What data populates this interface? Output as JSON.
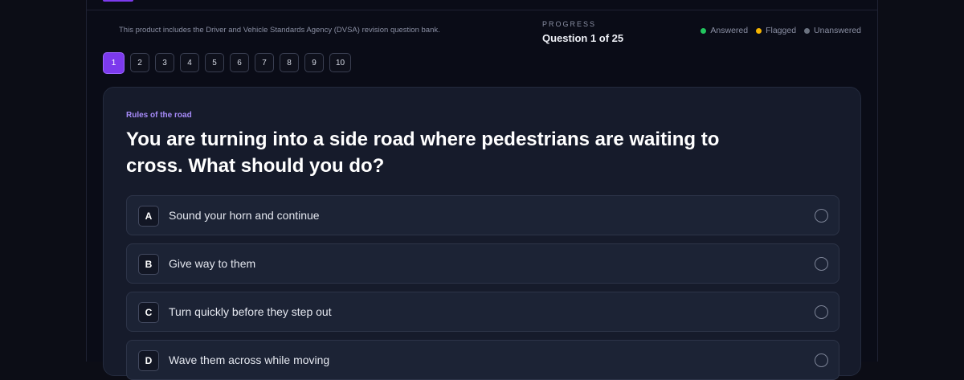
{
  "header": {
    "disclaimer": "This product includes the Driver and Vehicle Standards Agency (DVSA) revision question bank.",
    "progress_label": "PROGRESS",
    "progress_value": "Question 1 of 25"
  },
  "legend": [
    {
      "label": "Answered",
      "color": "#22c55e"
    },
    {
      "label": "Flagged",
      "color": "#f5b400"
    },
    {
      "label": "Unanswered",
      "color": "#6b7280"
    }
  ],
  "question_nav": {
    "items": [
      "1",
      "2",
      "3",
      "4",
      "5",
      "6",
      "7",
      "8",
      "9",
      "10"
    ],
    "active_index": 0
  },
  "question": {
    "category": "Rules of the road",
    "text": "You are turning into a side road where pedestrians are waiting to cross. What should you do?",
    "options": [
      {
        "letter": "A",
        "text": "Sound your horn and continue"
      },
      {
        "letter": "B",
        "text": "Give way to them"
      },
      {
        "letter": "C",
        "text": "Turn quickly before they step out"
      },
      {
        "letter": "D",
        "text": "Wave them across while moving"
      }
    ]
  },
  "colors": {
    "accent": "#7c3aed",
    "category": "#a78bfa"
  }
}
